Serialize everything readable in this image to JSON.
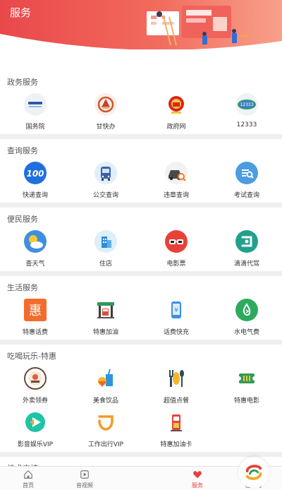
{
  "header": {
    "title": "服务"
  },
  "sections": [
    {
      "title": "政务服务",
      "items": [
        {
          "label": "国务院",
          "icon": "state-council-logo-icon"
        },
        {
          "label": "甘快办",
          "icon": "gansu-service-logo-icon"
        },
        {
          "label": "政府网",
          "icon": "national-emblem-icon"
        },
        {
          "label": "12333",
          "icon": "hrss-12333-logo-icon"
        }
      ]
    },
    {
      "title": "查询服务",
      "items": [
        {
          "label": "快递查询",
          "icon": "express-100-icon"
        },
        {
          "label": "公交查询",
          "icon": "bus-icon"
        },
        {
          "label": "违章查询",
          "icon": "car-search-icon"
        },
        {
          "label": "考试查询",
          "icon": "exam-search-icon"
        }
      ]
    },
    {
      "title": "便民服务",
      "items": [
        {
          "label": "查天气",
          "icon": "weather-icon"
        },
        {
          "label": "住店",
          "icon": "hotel-icon"
        },
        {
          "label": "电影票",
          "icon": "movie-glasses-icon"
        },
        {
          "label": "滴滴代驾",
          "icon": "didi-icon"
        }
      ]
    },
    {
      "title": "生活服务",
      "items": [
        {
          "label": "特惠话费",
          "icon": "discount-hui-icon"
        },
        {
          "label": "特惠加油",
          "icon": "gas-station-icon"
        },
        {
          "label": "话费快充",
          "icon": "phone-recharge-icon"
        },
        {
          "label": "水电气费",
          "icon": "utility-bill-icon"
        }
      ]
    },
    {
      "title": "吃喝玩乐-特惠",
      "items": [
        {
          "label": "外卖领券",
          "icon": "takeout-coupon-icon"
        },
        {
          "label": "美食饮品",
          "icon": "food-drink-icon"
        },
        {
          "label": "超值点餐",
          "icon": "dining-icon"
        },
        {
          "label": "特惠电影",
          "icon": "movie-ticket-icon"
        },
        {
          "label": "影音娱乐VIP",
          "icon": "video-vip-icon"
        },
        {
          "label": "工作出行VIP",
          "icon": "didi-travel-icon"
        },
        {
          "label": "特惠加油卡",
          "icon": "fuel-card-icon"
        }
      ]
    },
    {
      "title": "技术支持",
      "items": []
    }
  ],
  "tabbar": {
    "items": [
      {
        "label": "首页",
        "icon": "home-icon",
        "active": false
      },
      {
        "label": "音视频",
        "icon": "video-play-icon",
        "active": false
      },
      {
        "label": "",
        "icon": "center-logo-icon",
        "active": false
      },
      {
        "label": "服务",
        "icon": "heart-icon",
        "active": true
      },
      {
        "label": "庄浪号",
        "icon": "grid-circles-icon",
        "active": false
      }
    ]
  },
  "colors": {
    "accent": "#e5413a",
    "header_start": "#e9484b",
    "header_end": "#f7a08a"
  }
}
